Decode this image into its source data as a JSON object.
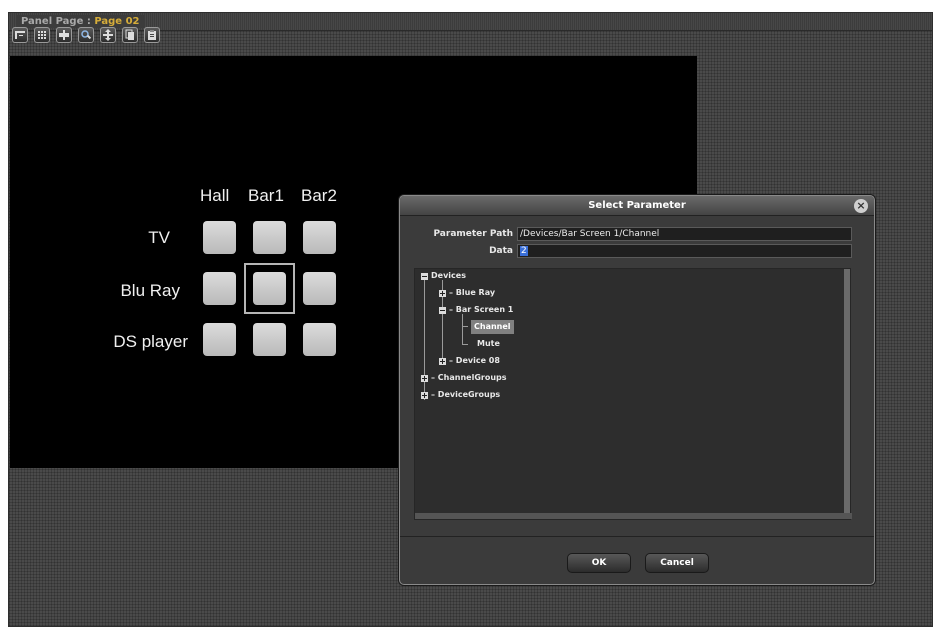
{
  "panel": {
    "title_prefix": "Panel Page :",
    "page_name": "Page 02"
  },
  "toolbar": {
    "tools": [
      {
        "icon": "properties-icon"
      },
      {
        "icon": "grid-icon"
      },
      {
        "icon": "align-icon"
      },
      {
        "icon": "zoom-x2-icon"
      },
      {
        "icon": "move-icon"
      },
      {
        "icon": "copy-icon"
      },
      {
        "icon": "paste-icon"
      }
    ]
  },
  "canvas": {
    "column_labels": [
      "Hall",
      "Bar1",
      "Bar2"
    ],
    "row_labels": [
      "TV",
      "Blu Ray",
      "DS player"
    ]
  },
  "dialog": {
    "title": "Select Parameter",
    "close_glyph": "×",
    "param_path_label": "Parameter Path",
    "param_path_value": "/Devices/Bar Screen 1/Channel",
    "data_label": "Data",
    "data_value": "2",
    "tree": {
      "devices": "Devices",
      "blue_ray": "Blue Ray",
      "bar_screen_1": "Bar Screen 1",
      "channel": "Channel",
      "mute": "Mute",
      "device_08": "Device 08",
      "channel_groups": "ChannelGroups",
      "device_groups": "DeviceGroups"
    },
    "ok_label": "OK",
    "cancel_label": "Cancel"
  }
}
